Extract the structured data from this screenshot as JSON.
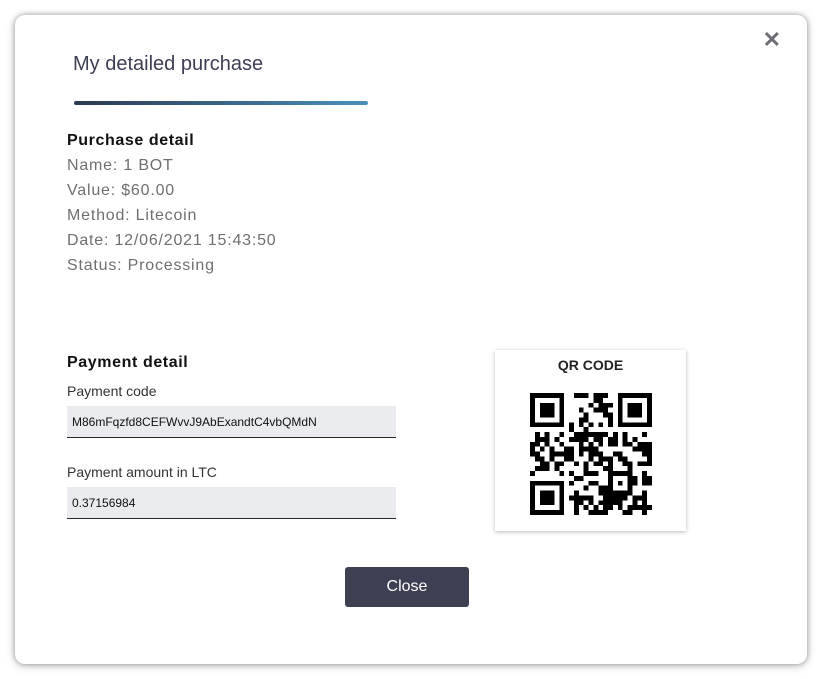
{
  "modal": {
    "title": "My detailed purchase",
    "close_icon": "close-icon"
  },
  "purchase": {
    "heading": "Purchase detail",
    "name": "Name: 1 BOT",
    "value": "Value: $60.00",
    "method": "Method: Litecoin",
    "date": "Date: 12/06/2021 15:43:50",
    "status": "Status: Processing"
  },
  "payment": {
    "heading": "Payment detail",
    "code_label": "Payment code",
    "code_value": "M86mFqzfd8CEFWvvJ9AbExandtC4vbQMdN",
    "amount_label": "Payment amount in LTC",
    "amount_value": "0.37156984"
  },
  "qr": {
    "title": "QR CODE"
  },
  "footer": {
    "close_label": "Close"
  },
  "colors": {
    "primary_dark": "#3d3f52",
    "accent_gradient_start": "#2b3a52",
    "accent_gradient_end": "#4a8fbd",
    "field_background": "#e9ebee"
  }
}
